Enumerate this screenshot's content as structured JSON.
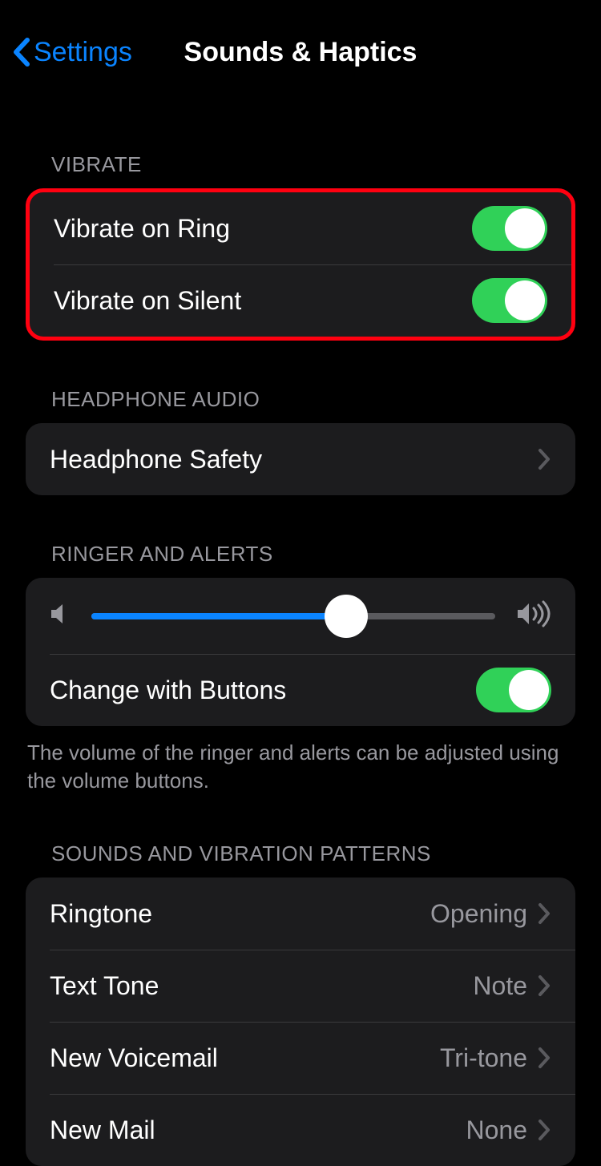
{
  "nav": {
    "back_label": "Settings",
    "title": "Sounds & Haptics"
  },
  "sections": {
    "vibrate": {
      "header": "VIBRATE",
      "ring_label": "Vibrate on Ring",
      "ring_on": true,
      "silent_label": "Vibrate on Silent",
      "silent_on": true
    },
    "headphone": {
      "header": "HEADPHONE AUDIO",
      "safety_label": "Headphone Safety"
    },
    "ringer": {
      "header": "RINGER AND ALERTS",
      "volume_percent": 63,
      "change_label": "Change with Buttons",
      "change_on": true,
      "footer": "The volume of the ringer and alerts can be adjusted using the volume buttons."
    },
    "sounds": {
      "header": "SOUNDS AND VIBRATION PATTERNS",
      "ringtone_label": "Ringtone",
      "ringtone_value": "Opening",
      "text_label": "Text Tone",
      "text_value": "Note",
      "voicemail_label": "New Voicemail",
      "voicemail_value": "Tri-tone",
      "mail_label": "New Mail",
      "mail_value": "None"
    }
  }
}
